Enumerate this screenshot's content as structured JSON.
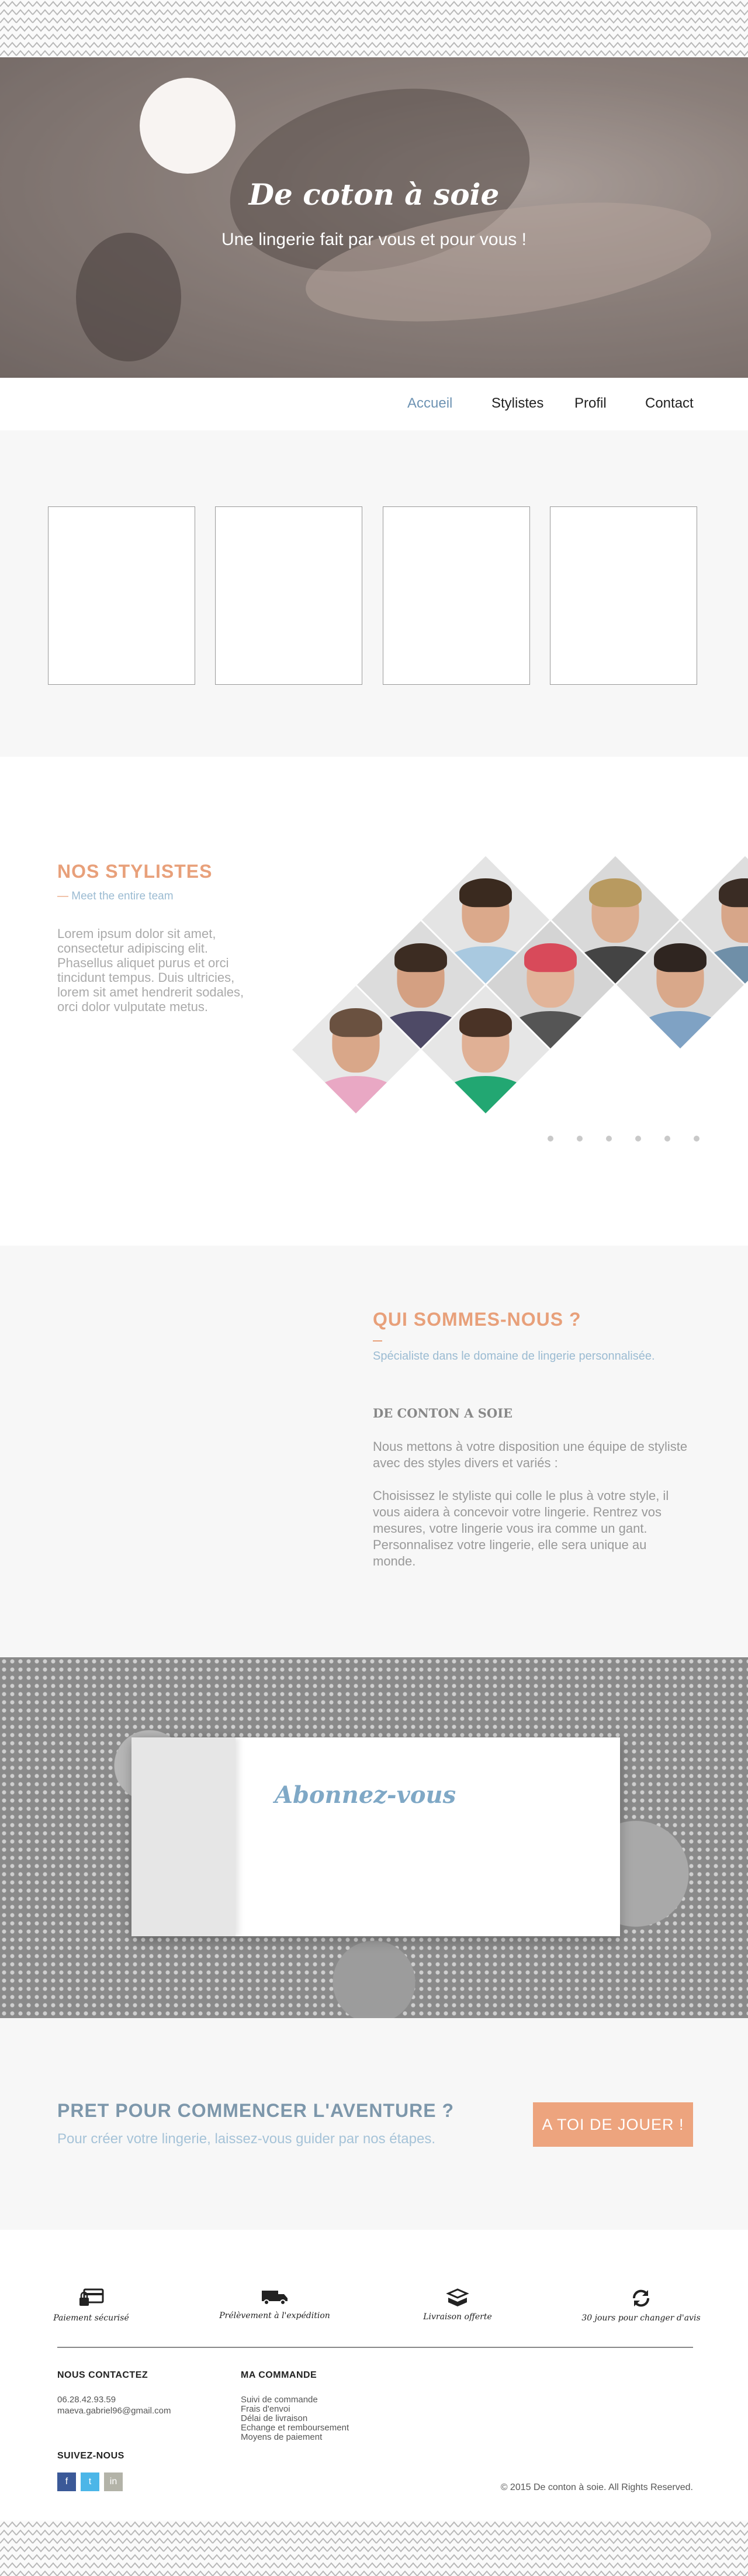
{
  "hero": {
    "title": "De coton à soie",
    "subtitle": "Une lingerie fait par vous et pour vous !"
  },
  "nav": {
    "items": [
      {
        "label": "Accueil",
        "active": true
      },
      {
        "label": "Stylistes",
        "active": false
      },
      {
        "label": "Profil",
        "active": false
      },
      {
        "label": "Contact",
        "active": false
      }
    ]
  },
  "stylists": {
    "title": "NOS STYLISTES",
    "subtitle": "Meet the entire team",
    "text": "Lorem ipsum dolor sit amet, consectetur adipiscing elit. Phasellus aliquet purus et orci tincidunt tempus. Duis ultricies, lorem sit amet hendrerit sodales, orci dolor vulputate metus.",
    "slider_dots": 6
  },
  "about": {
    "title": "QUI SOMMES-NOUS ?",
    "subtitle": "Spécialiste dans le domaine de lingerie personnalisée.",
    "heading": "DE CONTON A SOIE",
    "paragraph1": "Nous mettons à votre disposition une équipe de styliste avec des styles divers et variés :",
    "paragraph2": "Choisissez le styliste qui colle le plus à votre style, il vous aidera à concevoir votre lingerie. Rentrez vos mesures, votre lingerie vous ira comme un gant. Personnalisez votre lingerie, elle sera unique au monde."
  },
  "subscribe": {
    "title": "Abonnez-vous"
  },
  "cta": {
    "title": "PRET POUR COMMENCER L'AVENTURE ?",
    "subtitle": "Pour créer votre lingerie, laissez-vous guider par nos étapes.",
    "button": "A TOI DE JOUER !"
  },
  "footer": {
    "features": [
      {
        "label": "Paiement sécurisé",
        "icon": "secure-payment-icon"
      },
      {
        "label": "Prélèvement à l'expédition",
        "icon": "truck-icon"
      },
      {
        "label": "Livraison offerte",
        "icon": "box-icon"
      },
      {
        "label": "30 jours pour changer d'avis",
        "icon": "refresh-icon"
      }
    ],
    "contact": {
      "heading": "NOUS CONTACTEZ",
      "phone": "06.28.42.93.59",
      "email": "maeva.gabriel96@gmail.com"
    },
    "follow": {
      "heading": "SUIVEZ-NOUS",
      "networks": [
        "f",
        "t",
        "in"
      ],
      "colors": [
        "#3b5998",
        "#4cb6e8",
        "#b3b3a8"
      ]
    },
    "order": {
      "heading": "MA COMMANDE",
      "links": [
        "Suivi de commande",
        "Frais d'envoi",
        "Délai de livraison",
        "Echange et remboursement",
        "Moyens de paiement"
      ]
    },
    "copyright": "2015 De conton à soie. All Rights Reserved."
  },
  "colors": {
    "accent_orange": "#eda47e",
    "accent_blue": "#6e93b3"
  }
}
